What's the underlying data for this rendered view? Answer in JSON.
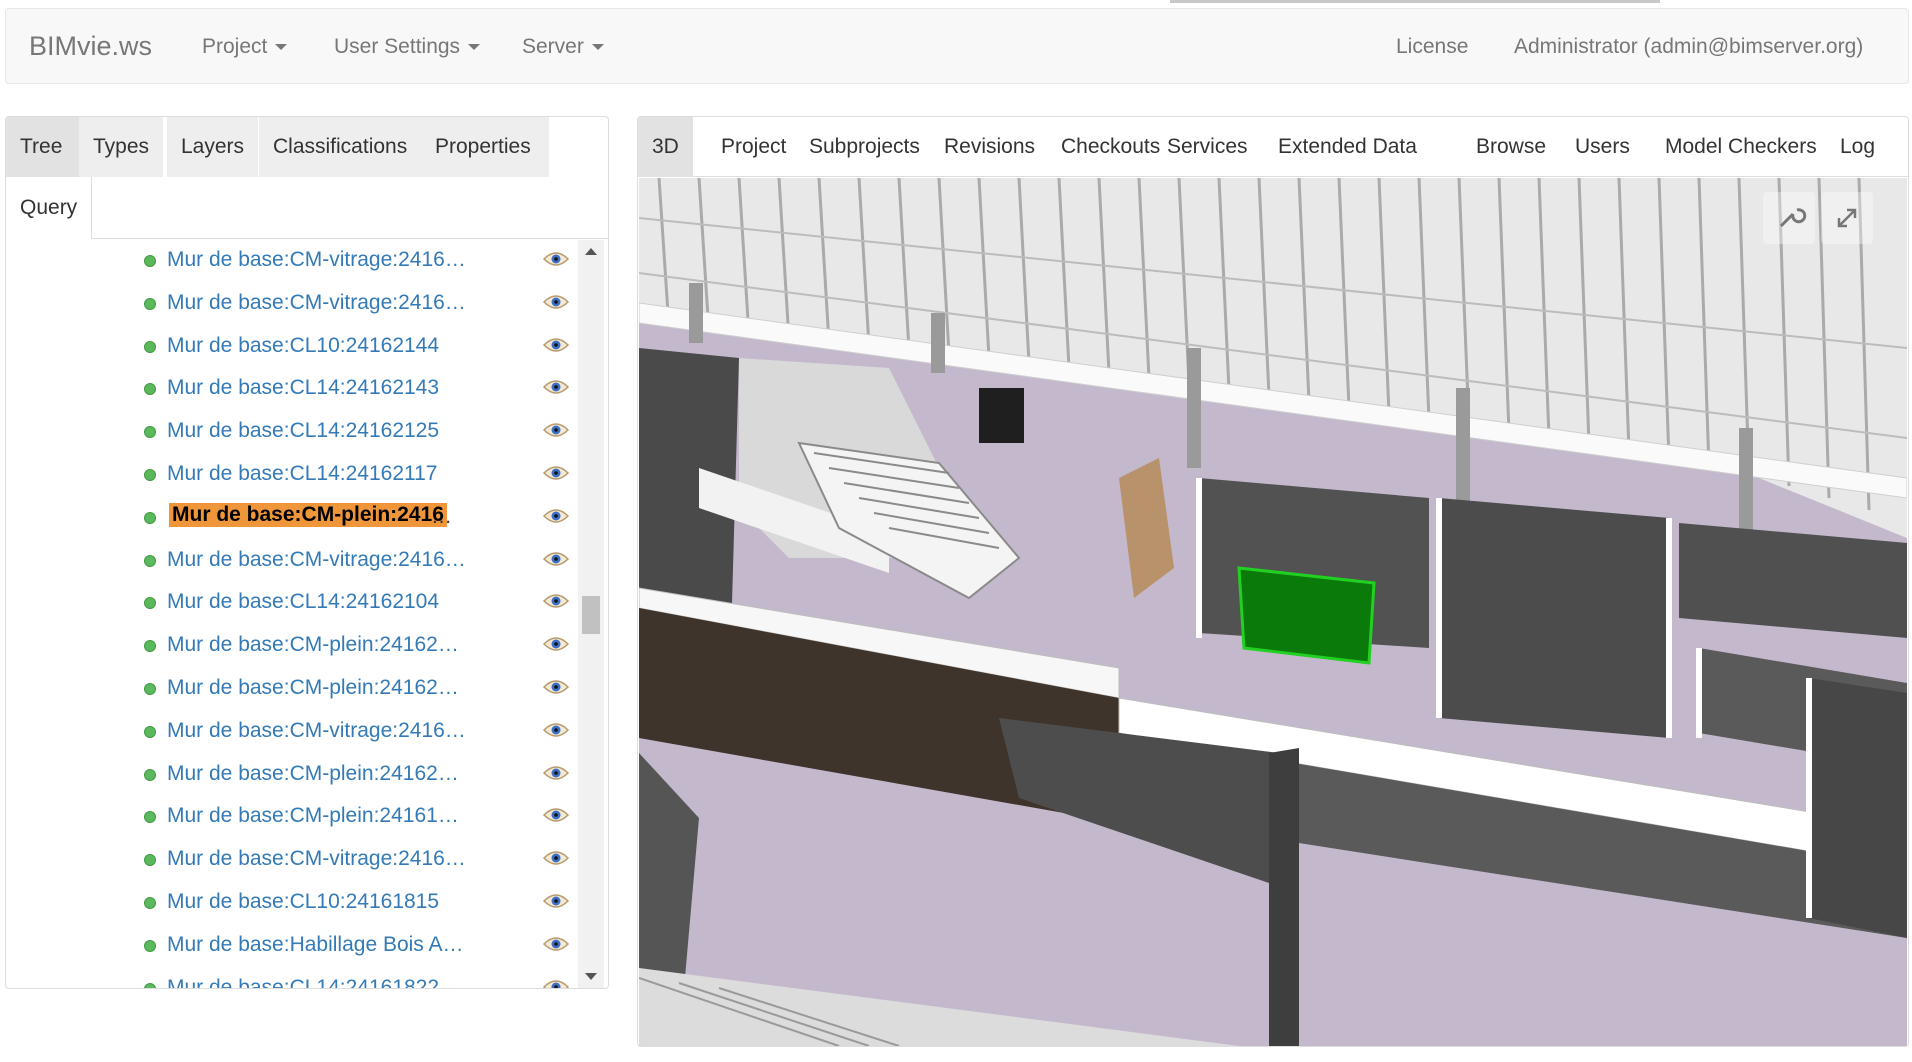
{
  "navbar": {
    "brand": "BIMvie.ws",
    "menus": [
      {
        "label": "Project"
      },
      {
        "label": "User Settings"
      },
      {
        "label": "Server"
      }
    ],
    "license": "License",
    "user": "Administrator (admin@bimserver.org)"
  },
  "left_tabs": {
    "tree": "Tree",
    "types": "Types",
    "layers": "Layers",
    "classifications": "Classifications",
    "properties": "Properties",
    "query": "Query"
  },
  "tree_items": [
    "Mur de base:CM-vitrage:2416…",
    "Mur de base:CM-vitrage:2416…",
    "Mur de base:CL10:24162144",
    "Mur de base:CL14:24162143",
    "Mur de base:CL14:24162125",
    "Mur de base:CL14:24162117",
    "Mur de base:CM-plein:2416",
    "Mur de base:CM-vitrage:2416…",
    "Mur de base:CL14:24162104",
    "Mur de base:CM-plein:24162…",
    "Mur de base:CM-plein:24162…",
    "Mur de base:CM-vitrage:2416…",
    "Mur de base:CM-plein:24162…",
    "Mur de base:CM-plein:24161…",
    "Mur de base:CM-vitrage:2416…",
    "Mur de base:CL10:24161815",
    "Mur de base:Habillage Bois A…",
    "Mur de base:CL14:24161822"
  ],
  "selected_index": 6,
  "selected_suffix": "…",
  "right_tabs": [
    "3D",
    "Project",
    "Subprojects",
    "Revisions",
    "Checkouts",
    "Services",
    "Extended Data",
    "Browse",
    "Users",
    "Model Checkers",
    "Log"
  ],
  "viewport_icons": [
    "wrench-icon",
    "fullscreen-icon"
  ],
  "colors": {
    "link": "#337ab7",
    "selected_highlight": "#f0963a",
    "node_dot": "#5cb85c",
    "floor": "#c4b8cd",
    "selected_wall": "#0a7a0a"
  }
}
